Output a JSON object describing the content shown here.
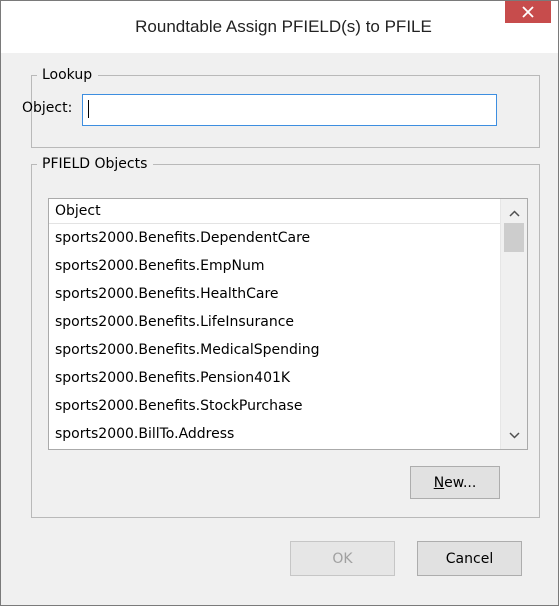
{
  "window": {
    "title": "Roundtable Assign PFIELD(s) to PFILE",
    "close_icon": "close-icon"
  },
  "lookup": {
    "legend": "Lookup",
    "object_label": "Object:",
    "object_value": ""
  },
  "objects": {
    "legend": "PFIELD Objects",
    "column_header": "Object",
    "items": [
      "sports2000.Benefits.DependentCare",
      "sports2000.Benefits.EmpNum",
      "sports2000.Benefits.HealthCare",
      "sports2000.Benefits.LifeInsurance",
      "sports2000.Benefits.MedicalSpending",
      "sports2000.Benefits.Pension401K",
      "sports2000.Benefits.StockPurchase",
      "sports2000.BillTo.Address"
    ],
    "new_button": "New..."
  },
  "footer": {
    "ok_label": "OK",
    "cancel_label": "Cancel"
  },
  "colors": {
    "close_button": "#c74c4c",
    "focus_border": "#3d8ee0",
    "dialog_background": "#f0f0f0"
  }
}
